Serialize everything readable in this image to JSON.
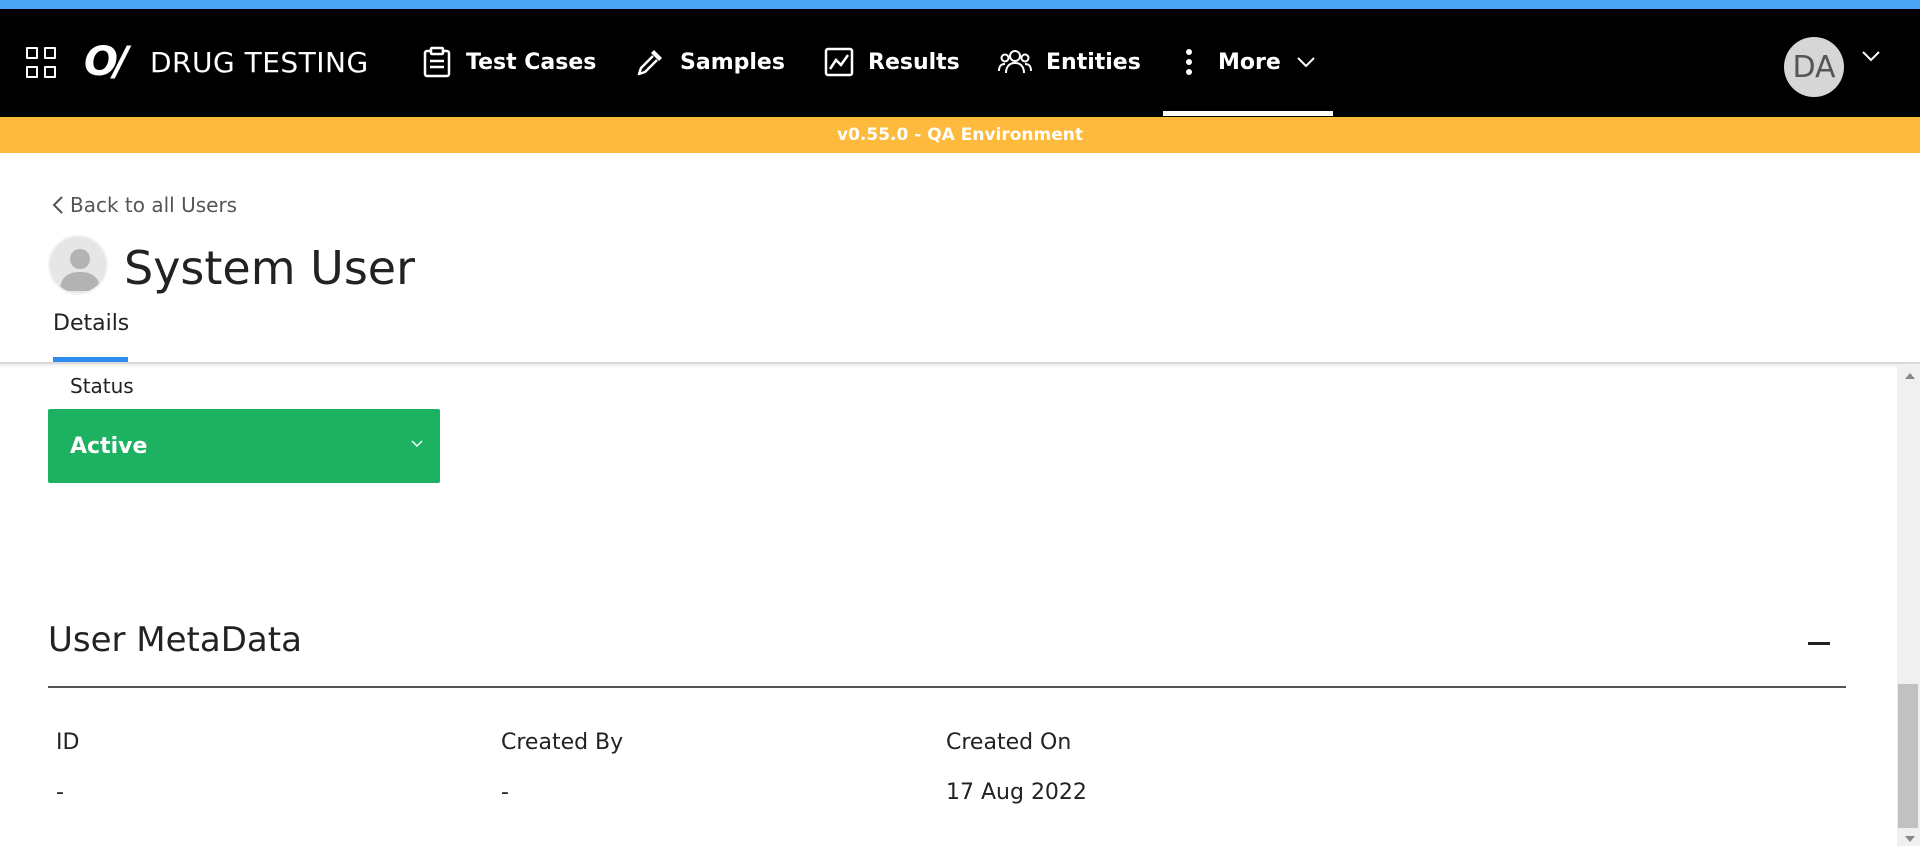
{
  "nav": {
    "app_name": "DRUG TESTING",
    "logo_mark": "O/",
    "items": [
      {
        "label": "Test Cases",
        "icon": "clipboard-icon"
      },
      {
        "label": "Samples",
        "icon": "pipette-icon"
      },
      {
        "label": "Results",
        "icon": "chart-line-icon"
      },
      {
        "label": "Entities",
        "icon": "people-icon"
      },
      {
        "label": "More",
        "icon": "more-vertical-icon"
      }
    ],
    "avatar_initials": "DA"
  },
  "env_banner": "v0.55.0 - QA Environment",
  "page": {
    "back_link": "Back to all Users",
    "title": "System User",
    "tabs": [
      {
        "label": "Details",
        "active": true
      }
    ]
  },
  "status": {
    "label": "Status",
    "value": "Active",
    "color": "#1db262"
  },
  "metadata": {
    "title": "User MetaData",
    "columns": [
      {
        "label": "ID",
        "value": "-"
      },
      {
        "label": "Created By",
        "value": "-"
      },
      {
        "label": "Created On",
        "value": "17 Aug 2022"
      }
    ]
  },
  "colors": {
    "top_strip": "#4aa3f5",
    "navbar": "#000000",
    "env_banner": "#fdba3c",
    "tab_accent": "#2e8cf0"
  }
}
